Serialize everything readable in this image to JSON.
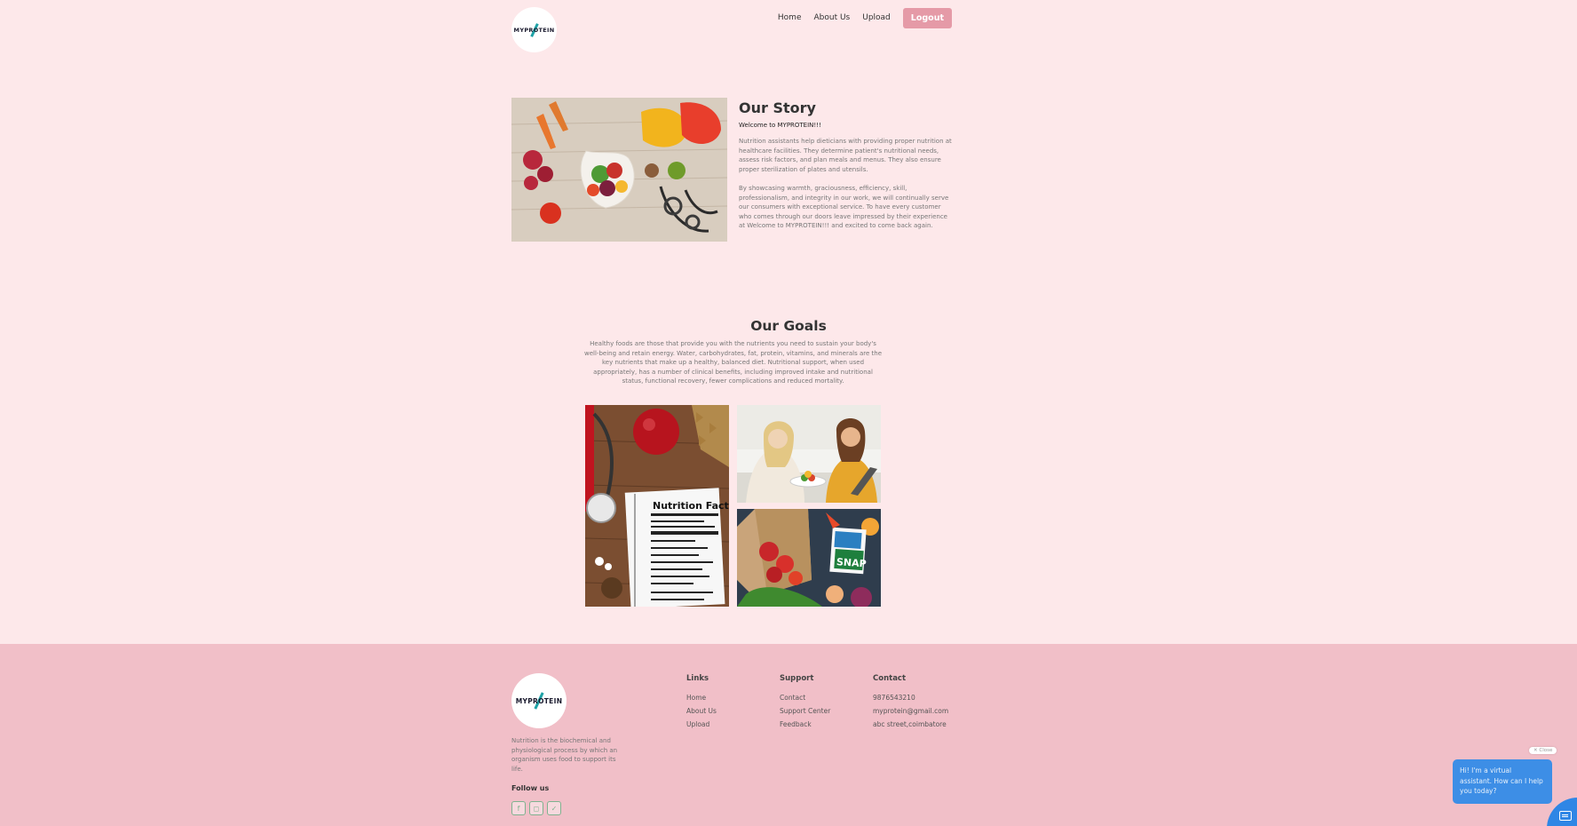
{
  "header": {
    "logo_text": "MYPROTEIN",
    "nav": {
      "home": "Home",
      "about": "About Us",
      "upload": "Upload",
      "logout": "Logout"
    }
  },
  "story": {
    "title": "Our Story",
    "welcome": "Welcome to MYPROTEIN!!!",
    "p1": "Nutrition assistants help dieticians with providing proper nutrition at healthcare facilities. They determine patient's nutritional needs, assess risk factors, and plan meals and menus. They also ensure proper sterilization of plates and utensils.",
    "p2": "By showcasing warmth, graciousness, efficiency, skill, professionalism, and integrity in our work, we will continually serve our consumers with exceptional service. To have every customer who comes through our doors leave impressed by their experience at Welcome to MYPROTEIN!!! and excited to come back again."
  },
  "goals": {
    "title": "Our Goals",
    "text": "Healthy foods are those that provide you with the nutrients you need to sustain your body's well-being and retain energy. Water, carbohydrates, fat, protein, vitamins, and minerals are the key nutrients that make up a healthy, balanced diet. Nutritional support, when used appropriately, has a number of clinical benefits, including improved intake and nutritional status, functional recovery, fewer complications and reduced mortality.",
    "img1_text": "Nutrition Facts",
    "img3_text": "SNAP"
  },
  "footer": {
    "logo_text": "MYPROTEIN",
    "description": "Nutrition is the biochemical and physiological process by which an organism uses food to support its life.",
    "follow": "Follow us",
    "social_icons": [
      "facebook-icon",
      "instagram-icon",
      "twitter-icon"
    ],
    "links": {
      "title": "Links",
      "items": [
        "Home",
        "About Us",
        "Upload"
      ]
    },
    "support": {
      "title": "Support",
      "items": [
        "Contact",
        "Support Center",
        "Feedback"
      ]
    },
    "contact": {
      "title": "Contact",
      "items": [
        "9876543210",
        "myprotein@gmail.com",
        "abc street,coimbatore"
      ]
    }
  },
  "chat": {
    "close": "✕ Close",
    "message": "Hi! I'm a virtual assistant. How can I help you today?"
  },
  "colors": {
    "background": "#fde8ea",
    "footer": "#f1bfc8",
    "logout": "#e59aa7",
    "chat": "#3d8ee6"
  }
}
